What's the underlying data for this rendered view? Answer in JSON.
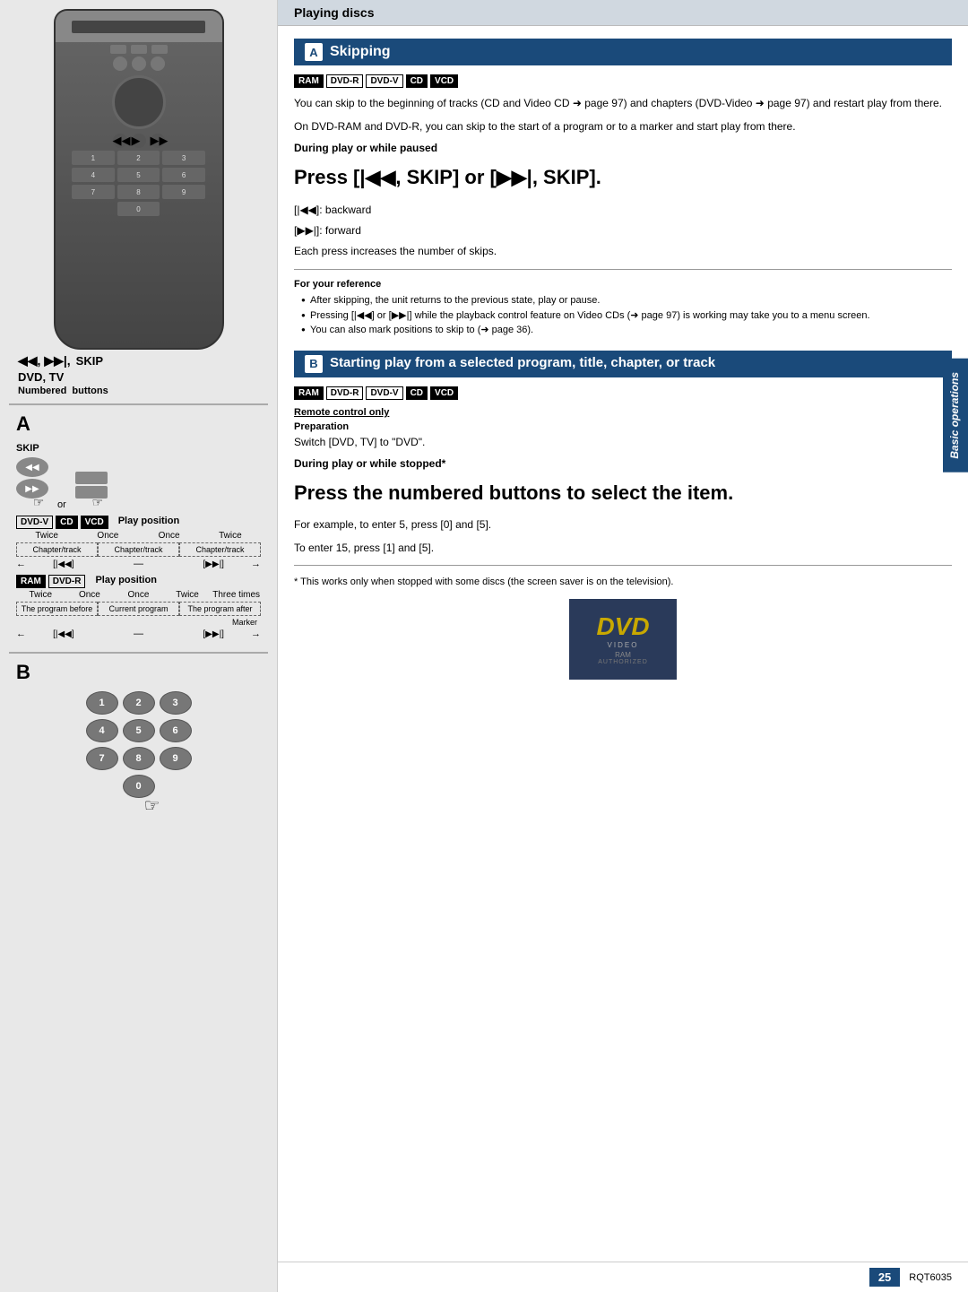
{
  "page": {
    "header": "Playing discs",
    "sidebar_label": "Basic operations",
    "page_number": "25",
    "page_code": "RQT6035"
  },
  "section_a": {
    "letter": "A",
    "title": "Skipping",
    "badges": [
      "RAM",
      "DVD-R",
      "DVD-V",
      "CD",
      "VCD"
    ],
    "badges_dark": [
      "CD",
      "VCD"
    ],
    "intro_text1": "You can skip to the beginning of tracks (CD and Video CD ➜ page 97) and chapters (DVD-Video ➜ page 97) and restart play from there.",
    "intro_text2": "On DVD-RAM and DVD-R, you can skip to the start of a program or to a marker and start play from there.",
    "during_play_heading": "During play or while paused",
    "big_instruction": "Press [|◀◀, SKIP] or [▶▶|, SKIP].",
    "backward_label": "[|◀◀]:  backward",
    "forward_label": "[▶▶|]:  forward",
    "each_press": "Each press increases the number of skips.",
    "ref_heading": "For your reference",
    "bullets": [
      "After skipping, the unit returns to the previous state, play or pause.",
      "Pressing [|◀◀] or [▶▶|] while the playback control feature on Video CDs (➜ page 97) is working may take you to a menu screen.",
      "You can also mark positions to skip to (➜ page 36)."
    ]
  },
  "section_b": {
    "letter": "B",
    "title": "Starting play from a selected program, title, chapter, or track",
    "badges": [
      "RAM",
      "DVD-R",
      "DVD-V",
      "CD",
      "VCD"
    ],
    "badges_dark": [
      "CD",
      "VCD"
    ],
    "remote_control_only": "Remote control only",
    "preparation_heading": "Preparation",
    "preparation_text": "Switch [DVD, TV] to \"DVD\".",
    "during_play_stopped": "During play or while stopped*",
    "big_instruction2": "Press the numbered buttons to select the item.",
    "example1": "For example, to enter 5, press [0] and [5].",
    "example2": "To enter 15, press [1] and [5].",
    "footnote": "* This works only when stopped with some discs (the screen saver is on the television)."
  },
  "diagram_a": {
    "skip_label": "SKIP",
    "or_label": "or",
    "dvdv_badge": "DVD-V",
    "cd_badge": "CD",
    "vcd_badge": "VCD",
    "play_position_label": "Play position",
    "row1_labels": [
      "Twice",
      "Once",
      "Once",
      "Twice"
    ],
    "row1_chapters": [
      "Chapter/track",
      "Chapter/track",
      "Chapter/track"
    ],
    "row1_arrows_left": "←",
    "row1_icon_left": "[|◀◀]",
    "row1_center": "—",
    "row1_icon_right": "[▶▶|]",
    "row1_arrows_right": "→",
    "ram_badge": "RAM",
    "dvdr_badge": "DVD-R",
    "play_position_label2": "Play position",
    "row2_labels": [
      "Twice",
      "Once",
      "Once",
      "Twice",
      "Three times"
    ],
    "row2_boxes": [
      "The program before",
      "Current program",
      "The program after"
    ],
    "row2_arrows_left": "←",
    "row2_icon_left": "[|◀◀]",
    "row2_center": "—",
    "row2_icon_right": "[▶▶|]",
    "row2_arrows_right": "→",
    "marker_label": "Marker"
  },
  "remote": {
    "skip_label": "◀◀, ▶▶|,",
    "skip_text": "SKIP",
    "dvd_tv_label": "DVD, TV",
    "numbered_buttons": "Numbered",
    "buttons_label": "buttons"
  },
  "dvd_logo": {
    "text": "DVD",
    "sub": "VIDEO"
  },
  "numbers": [
    "1",
    "2",
    "3",
    "4",
    "5",
    "6",
    "7",
    "8",
    "9",
    "0"
  ]
}
